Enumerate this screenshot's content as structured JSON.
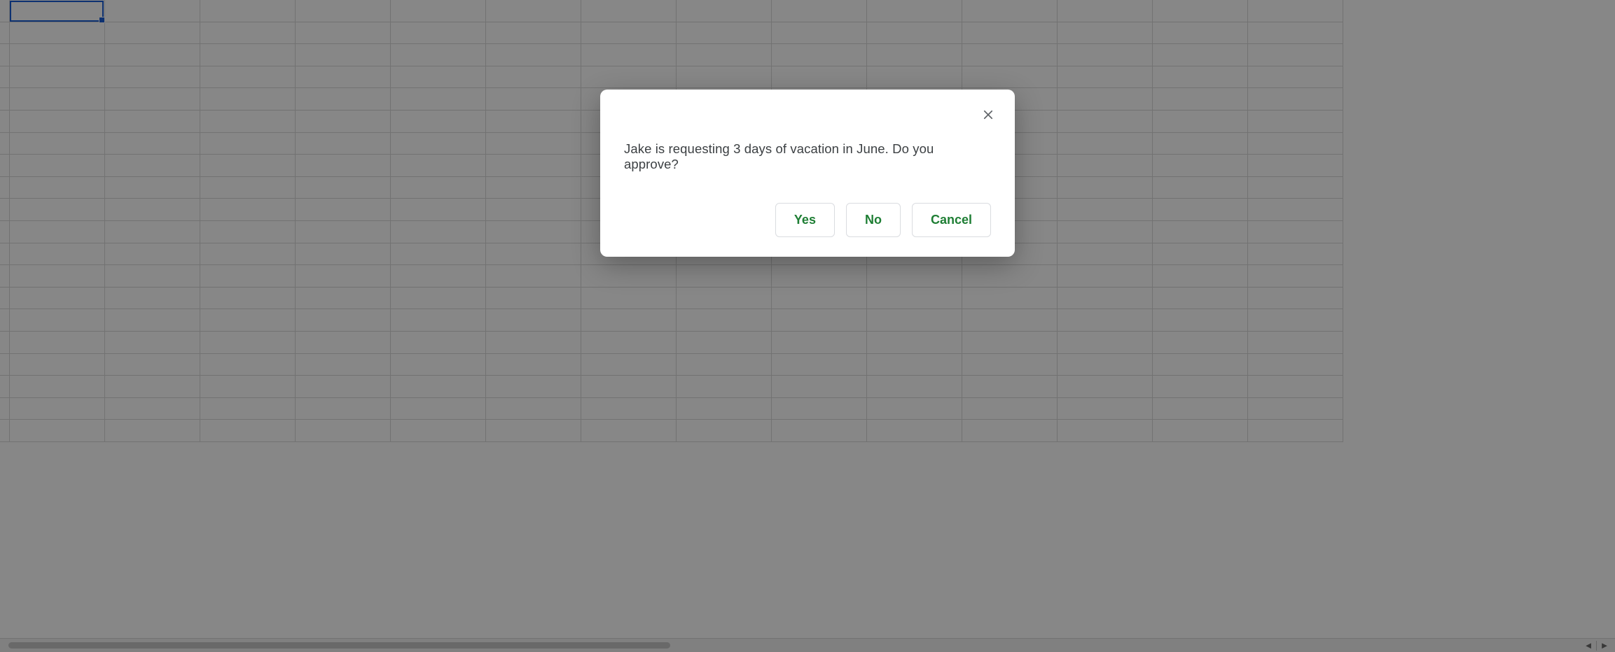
{
  "dialog": {
    "message": "Jake is requesting 3 days of vacation in June. Do you approve?",
    "buttons": {
      "yes": "Yes",
      "no": "No",
      "cancel": "Cancel"
    }
  },
  "sheet": {
    "rows": 20,
    "cols": 14,
    "selected_cell": "A1"
  },
  "scroll": {
    "left_arrow": "◄",
    "right_arrow": "►"
  }
}
